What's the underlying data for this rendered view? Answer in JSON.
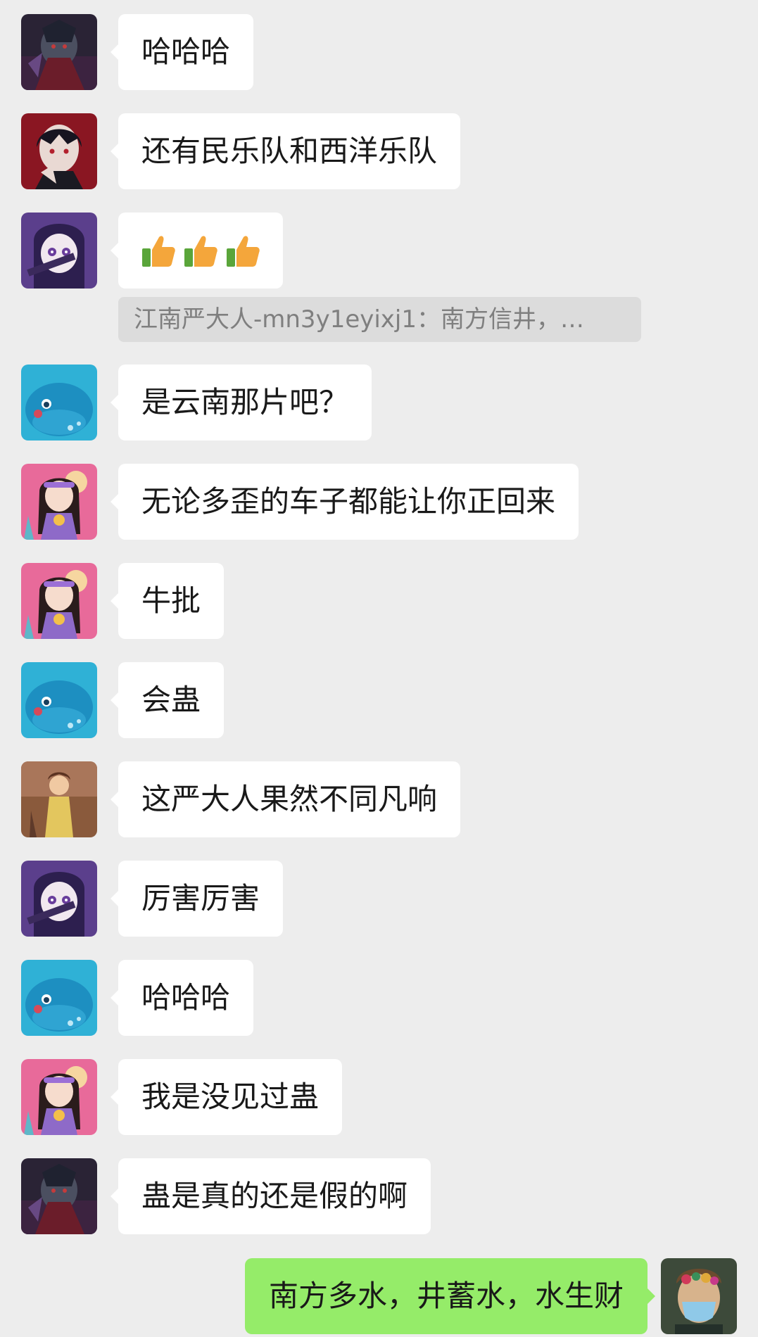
{
  "messages": [
    {
      "avatar": "dark-warrior-avatar",
      "text": "哈哈哈"
    },
    {
      "avatar": "dark-hair-boy-avatar",
      "text": "还有民乐队和西洋乐队"
    },
    {
      "avatar": "purple-anime-avatar",
      "text": "👍👍👍"
    },
    {
      "avatar": "blue-whale-avatar",
      "text": "是云南那片吧？"
    },
    {
      "avatar": "pink-girl-avatar",
      "text": "无论多歪的车子都能让你正回来"
    },
    {
      "avatar": "pink-girl-avatar",
      "text": "牛批"
    },
    {
      "avatar": "blue-whale-avatar",
      "text": "会蛊"
    },
    {
      "avatar": "brown-lady-avatar",
      "text": "这严大人果然不同凡响"
    },
    {
      "avatar": "purple-anime-avatar",
      "text": "厉害厉害"
    },
    {
      "avatar": "blue-whale-avatar",
      "text": "哈哈哈"
    },
    {
      "avatar": "pink-girl-avatar",
      "text": "我是没见过蛊"
    },
    {
      "avatar": "dark-warrior-avatar",
      "text": "蛊是真的还是假的啊"
    }
  ],
  "quote": {
    "text": "江南严大人-mn3y1eyixj1：南方信井，…"
  },
  "self_message": {
    "avatar": "masked-portrait-avatar",
    "text": "南方多水，井蓄水，水生财"
  },
  "colors": {
    "background": "#ededed",
    "bubble_other": "#ffffff",
    "bubble_self": "#95ec69",
    "quote_bg": "#dcdcdc",
    "quote_text": "#7f7f7f"
  }
}
